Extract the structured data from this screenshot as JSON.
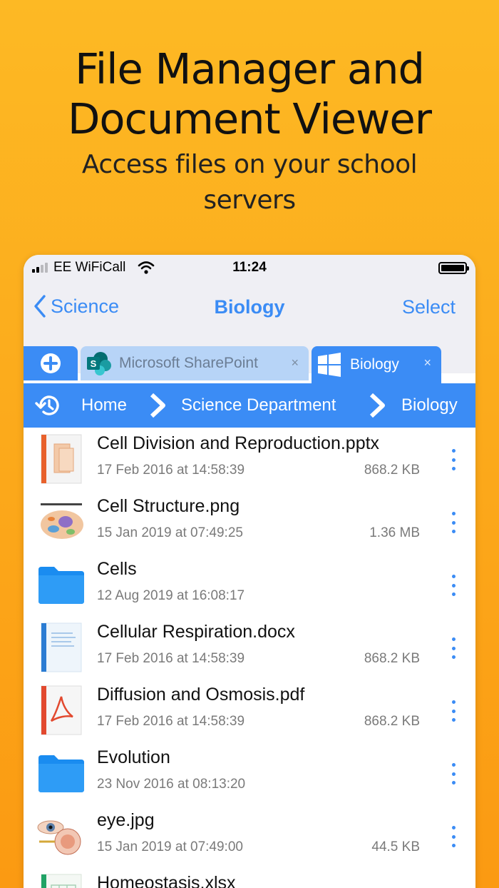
{
  "promo": {
    "title_line1": "File Manager and",
    "title_line2": "Document Viewer",
    "subtitle_line1": "Access files on your school",
    "subtitle_line2": "servers"
  },
  "status": {
    "carrier": "EE WiFiCall",
    "time": "11:24"
  },
  "nav": {
    "back_label": "Science",
    "title": "Biology",
    "select_label": "Select"
  },
  "tabs": [
    {
      "label": "Microsoft SharePoint",
      "close": "×"
    },
    {
      "label": "Biology",
      "close": "×"
    }
  ],
  "breadcrumb": [
    "Home",
    "Science Department",
    "Biology"
  ],
  "files": [
    {
      "name": "Cell Division and Reproduction.pptx",
      "date": "17 Feb 2016 at 14:58:39",
      "size": "868.2 KB",
      "icon": "pptx-icon"
    },
    {
      "name": "Cell Structure.png",
      "date": "15 Jan 2019 at 07:49:25",
      "size": "1.36 MB",
      "icon": "image-thumbnail"
    },
    {
      "name": "Cells",
      "date": "12 Aug 2019 at 16:08:17",
      "size": "",
      "icon": "folder-icon"
    },
    {
      "name": "Cellular Respiration.docx",
      "date": "17 Feb 2016 at 14:58:39",
      "size": "868.2 KB",
      "icon": "docx-icon"
    },
    {
      "name": "Diffusion and Osmosis.pdf",
      "date": "17 Feb 2016 at 14:58:39",
      "size": "868.2 KB",
      "icon": "pdf-icon"
    },
    {
      "name": "Evolution",
      "date": "23 Nov 2016 at 08:13:20",
      "size": "",
      "icon": "folder-icon"
    },
    {
      "name": "eye.jpg",
      "date": "15 Jan 2019 at 07:49:00",
      "size": "44.5 KB",
      "icon": "image-thumbnail"
    },
    {
      "name": "Homeostasis.xlsx",
      "date": "",
      "size": "",
      "icon": "xlsx-icon"
    }
  ],
  "colors": {
    "accent": "#3b8cf5",
    "background": "#fca81a",
    "tab_inactive": "#b7d4f7"
  }
}
